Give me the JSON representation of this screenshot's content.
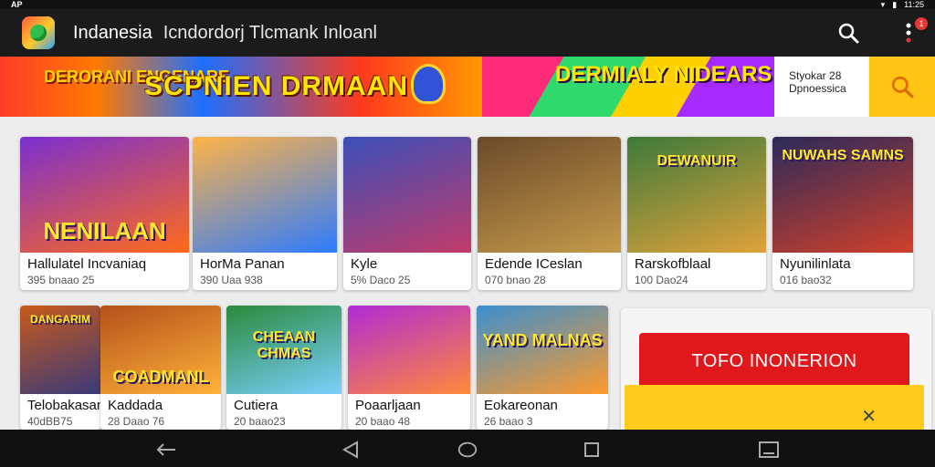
{
  "status_bar": {
    "left_text": "AP",
    "time": "11:25"
  },
  "app_bar": {
    "title": "Indanesia",
    "subtitle": "Icndordorj Tlcmank Inloanl",
    "notification_count": "1"
  },
  "banner": {
    "logo_text": "DERORANI ENGENARE",
    "headline": "SCPNIEN DRMAAN",
    "promo_text": "DERMIALY NIDEARS",
    "info_line1": "Styokar 28",
    "info_line2": "Dpnoessica"
  },
  "games_row1": [
    {
      "title": "Hallulatel Incvaniaq",
      "meta": "395 bnaao 25",
      "art_label": "NENILAAN",
      "bg": "#7b2fd0",
      "bg2": "#ff6a1a"
    },
    {
      "title": "HorMa Panan",
      "meta": "390 Uaa 938",
      "art_label": "",
      "bg": "#ffb347",
      "bg2": "#2d7bff"
    },
    {
      "title": "Kyle",
      "meta": "5% Daco 25",
      "art_label": "",
      "bg": "#3a4fb8",
      "bg2": "#c23b6a"
    },
    {
      "title": "Edende ICeslan",
      "meta": "070 bnao 28",
      "art_label": "",
      "bg": "#6b4a2a",
      "bg2": "#c59a4a"
    },
    {
      "title": "Rarskofblaal",
      "meta": "100 Dao24",
      "art_label": "DEWANUIR",
      "bg": "#3d7a3a",
      "bg2": "#e0a23a"
    },
    {
      "title": "Nyunilinlata",
      "meta": "016 bao32",
      "art_label": "NUWAHS SAMNS",
      "bg": "#2b2a5a",
      "bg2": "#d0402a"
    }
  ],
  "games_row2": [
    {
      "title": "Telobakasan",
      "meta": "40dBB75",
      "art_label": "DANGARIM",
      "bg": "#c85a1a",
      "bg2": "#3a3a7a"
    },
    {
      "title": "Kaddada",
      "meta": "28 Daao 76",
      "art_label": "COADMANL",
      "bg": "#b4511a",
      "bg2": "#ffb23a"
    },
    {
      "title": "Cutiera",
      "meta": "20 baao23",
      "art_label": "CHEAAN CHMAS",
      "bg": "#2a8a3a",
      "bg2": "#7ad0ff"
    },
    {
      "title": "Poaarljaan",
      "meta": "20 baao 48",
      "art_label": "",
      "bg": "#b12ad6",
      "bg2": "#ff8a3a"
    },
    {
      "title": "Eokareonan",
      "meta": "26 baao 3",
      "art_label": "YAND MALNAS",
      "bg": "#3a8fd0",
      "bg2": "#ff9a2a"
    }
  ],
  "side_panel": {
    "cta_label": "TOFO INONERION",
    "secondary_mark": "✕"
  },
  "colors": {
    "accent_red": "#e0171b",
    "accent_yellow": "#ffc515",
    "app_bar": "#1b1b1b"
  }
}
